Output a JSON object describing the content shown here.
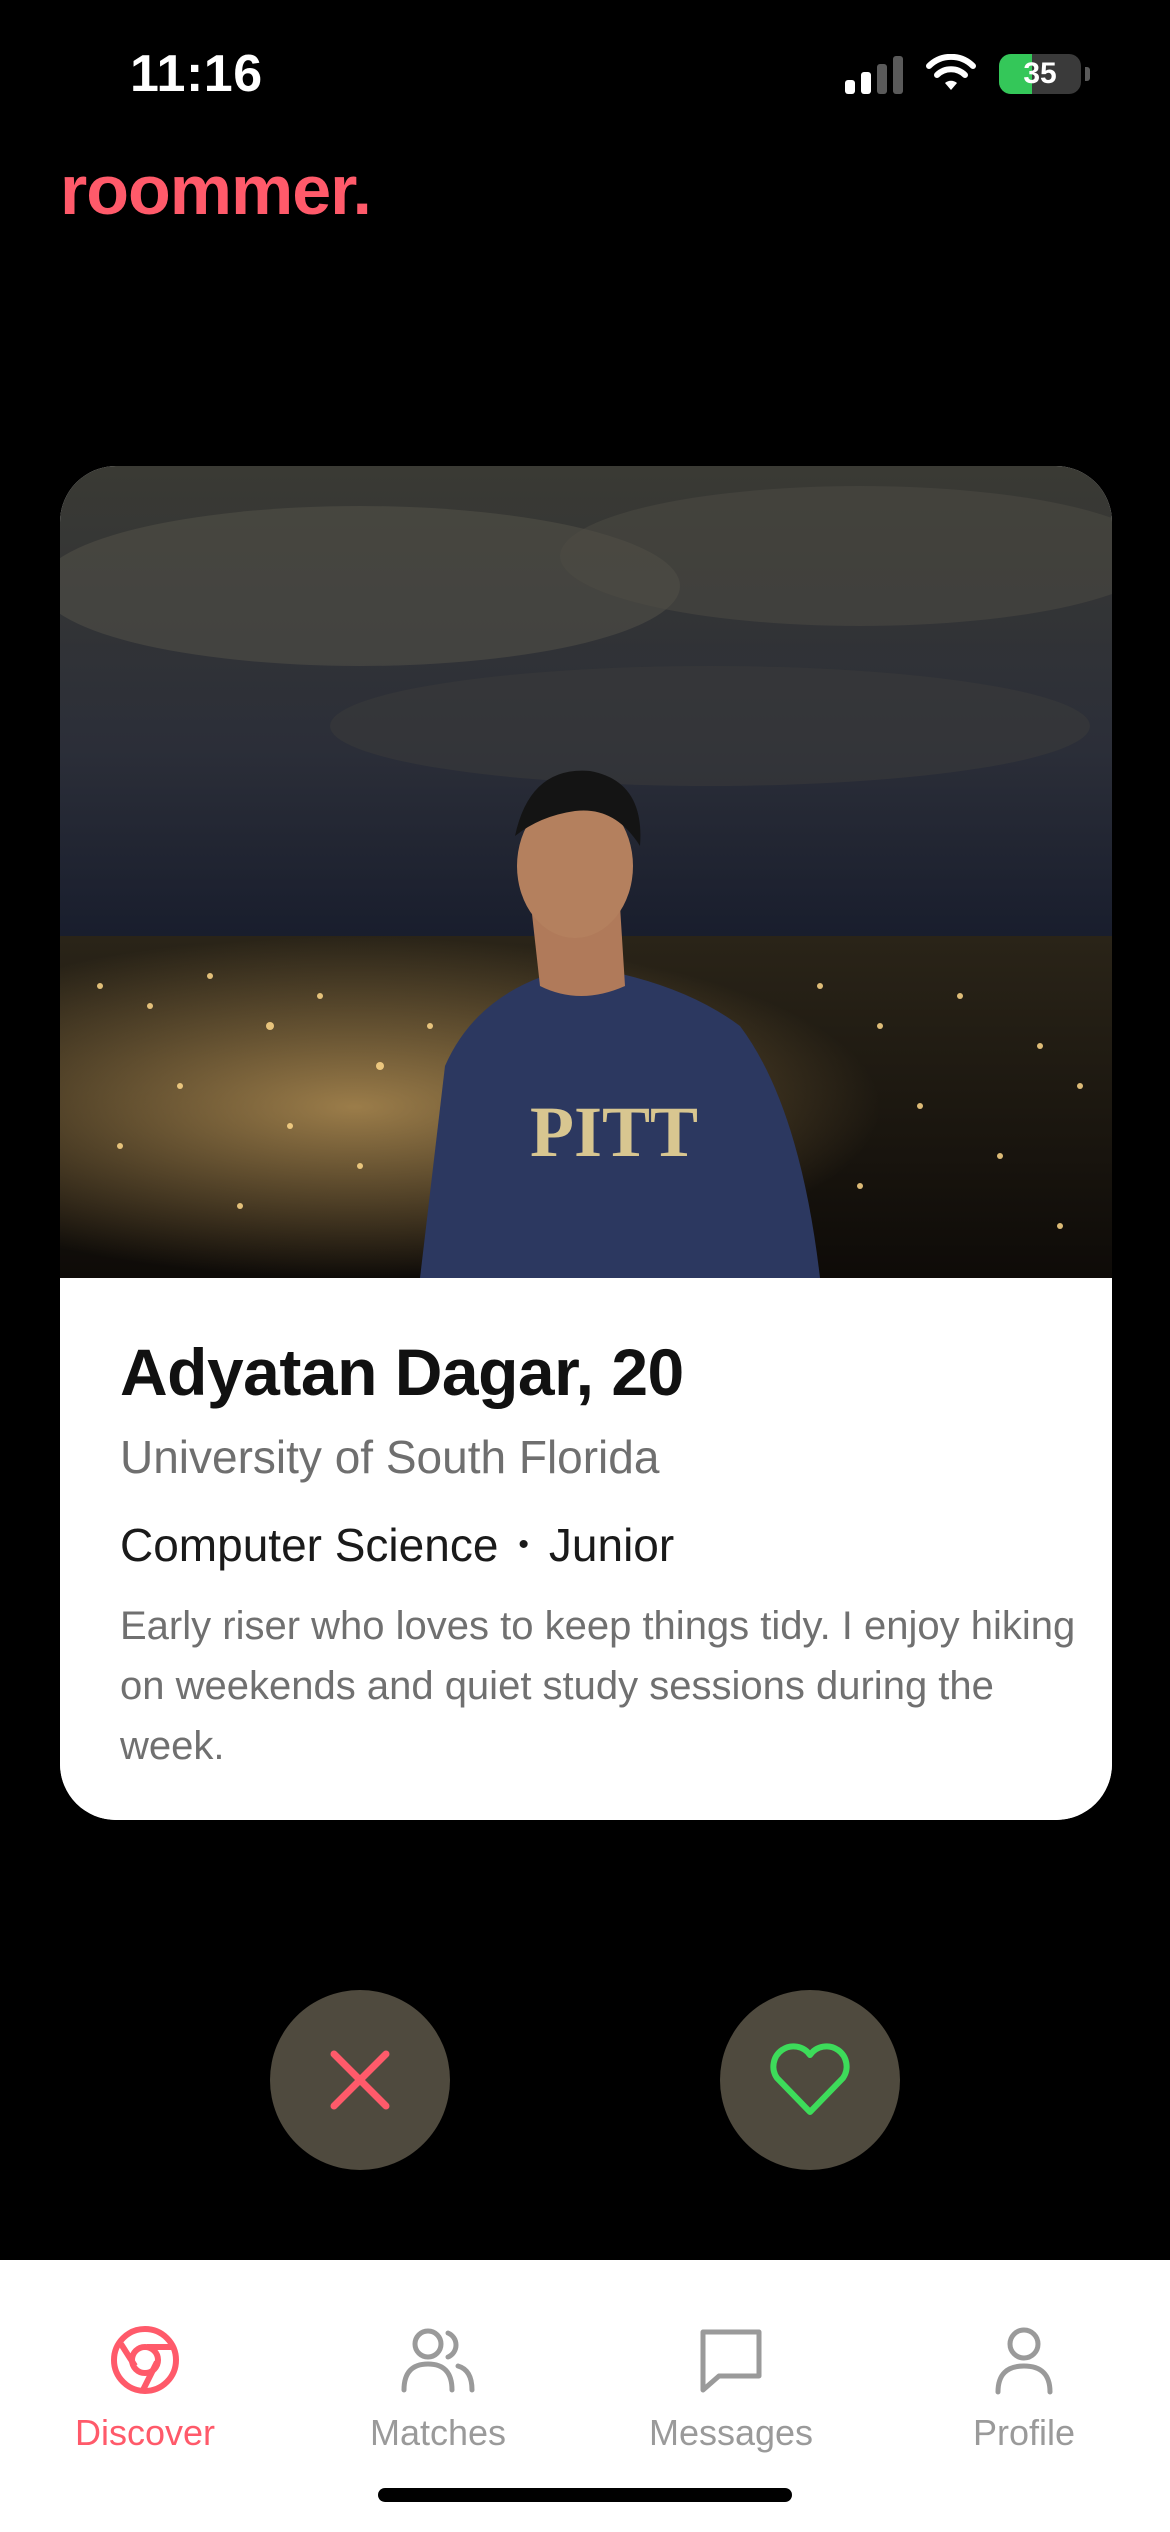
{
  "status": {
    "time": "11:16",
    "battery": "35"
  },
  "app": {
    "name": "roommer."
  },
  "profile": {
    "name_age": "Adyatan Dagar, 20",
    "university": "University of South Florida",
    "major": "Computer Science",
    "separator": "•",
    "year": "Junior",
    "bio": "Early riser who loves to keep things tidy. I enjoy hiking on weekends and quiet study sessions during the week.",
    "photo_icon": "profile-photo-night-city"
  },
  "actions": {
    "pass_icon": "x-icon",
    "like_icon": "heart-icon"
  },
  "tabs": [
    {
      "label": "Discover",
      "icon": "discover-icon",
      "active": true
    },
    {
      "label": "Matches",
      "icon": "people-icon",
      "active": false
    },
    {
      "label": "Messages",
      "icon": "message-icon",
      "active": false
    },
    {
      "label": "Profile",
      "icon": "person-icon",
      "active": false
    }
  ],
  "colors": {
    "brand": "#ff5a6a",
    "like": "#3ddc5a",
    "button_bg": "#4f4a3e",
    "inactive_tab": "#9a9a9a"
  }
}
